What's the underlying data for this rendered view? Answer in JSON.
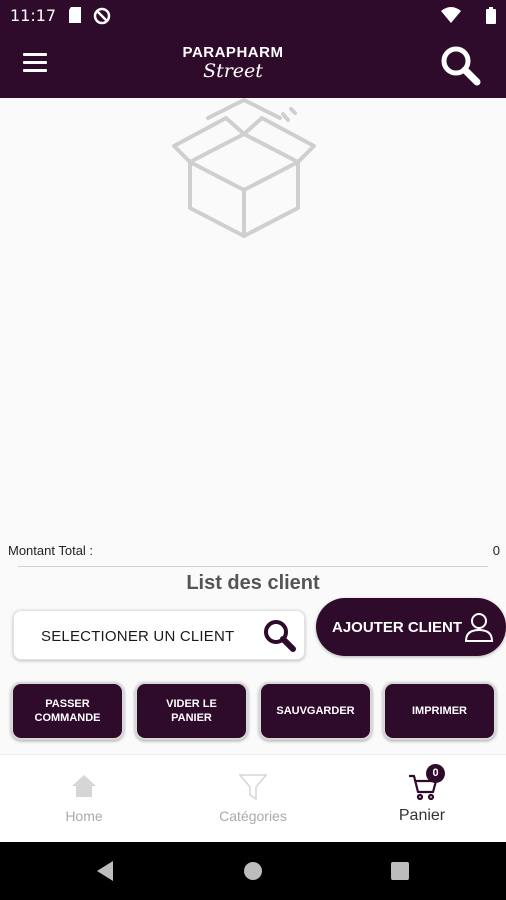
{
  "status_bar": {
    "time": "11:17",
    "icons": [
      "sd-card-icon",
      "no-disturb-icon",
      "wifi-icon",
      "battery-icon"
    ]
  },
  "header": {
    "logo_line1": "PARAPHARM",
    "logo_line2": "Street",
    "menu_icon": "hamburger-menu-icon",
    "search_icon": "search-icon"
  },
  "cart": {
    "empty_icon": "open-box-icon",
    "total_label": "Montant Total :",
    "total_value": "0"
  },
  "client_section": {
    "title": "List des client",
    "select_label": "SELECTIONER UN CLIENT",
    "add_label": "AJOUTER CLIENT"
  },
  "actions": {
    "passer": "PASSER COMMANDE",
    "vider": "VIDER LE PANIER",
    "sauvgarder": "SAUVGARDER",
    "imprimer": "IMPRIMER"
  },
  "bottom_nav": {
    "home": "Home",
    "categories": "Catégories",
    "panier": "Panier",
    "badge": "0"
  },
  "colors": {
    "brand": "#2e0b2b",
    "background": "#fafafa"
  }
}
